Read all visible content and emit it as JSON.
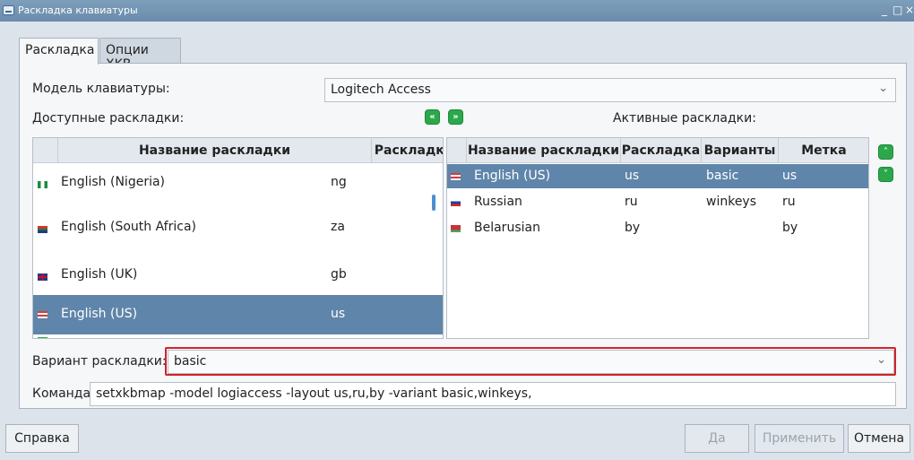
{
  "window": {
    "title": "Раскладка клавиатуры",
    "controls": [
      "_",
      "□",
      "×"
    ]
  },
  "tabs": [
    {
      "label": "Раскладка",
      "active": true
    },
    {
      "label": "Опции XKB",
      "active": false
    }
  ],
  "model": {
    "label": "Модель клавиатуры:",
    "value": "Logitech Access"
  },
  "available": {
    "label": "Доступные раскладки:",
    "columns": [
      "Название раскладки",
      "Раскладка"
    ],
    "rows": [
      {
        "name": "English (Nigeria)",
        "code": "ng",
        "flag": "flag-nigeria-icon",
        "selected": false
      },
      {
        "name": "English (South Africa)",
        "code": "za",
        "flag": "flag-south-africa-icon",
        "selected": false
      },
      {
        "name": "English (UK)",
        "code": "gb",
        "flag": "flag-uk-icon",
        "selected": false
      },
      {
        "name": "English (US)",
        "code": "us",
        "flag": "flag-us-icon",
        "selected": true
      }
    ]
  },
  "move_buttons": {
    "remove_icon": "double-left-arrow-icon",
    "add_icon": "double-right-arrow-icon",
    "remove_glyph": "«",
    "add_glyph": "»"
  },
  "active": {
    "label": "Активные раскладки:",
    "columns": [
      "Название раскладки",
      "Раскладка",
      "Варианты",
      "Метка"
    ],
    "rows": [
      {
        "name": "English (US)",
        "code": "us",
        "variant": "basic",
        "label": "us",
        "flag": "flag-us-icon",
        "selected": true
      },
      {
        "name": "Russian",
        "code": "ru",
        "variant": "winkeys",
        "label": "ru",
        "flag": "flag-russia-icon",
        "selected": false
      },
      {
        "name": "Belarusian",
        "code": "by",
        "variant": "",
        "label": "by",
        "flag": "flag-belarus-icon",
        "selected": false
      }
    ],
    "up_icon": "move-up-icon",
    "down_icon": "move-down-icon",
    "up_glyph": "˄",
    "down_glyph": "˅"
  },
  "variant": {
    "label": "Вариант раскладки:",
    "value": "basic"
  },
  "command": {
    "label": "Команда:",
    "value": "setxkbmap -model logiaccess -layout us,ru,by -variant basic,winkeys,"
  },
  "buttons": {
    "help": "Справка",
    "ok": "Да",
    "apply": "Применить",
    "cancel": "Отмена"
  },
  "colors": {
    "selection": "#5f85aa",
    "accent_green": "#2ba84a",
    "highlight_red": "#d2232a"
  }
}
